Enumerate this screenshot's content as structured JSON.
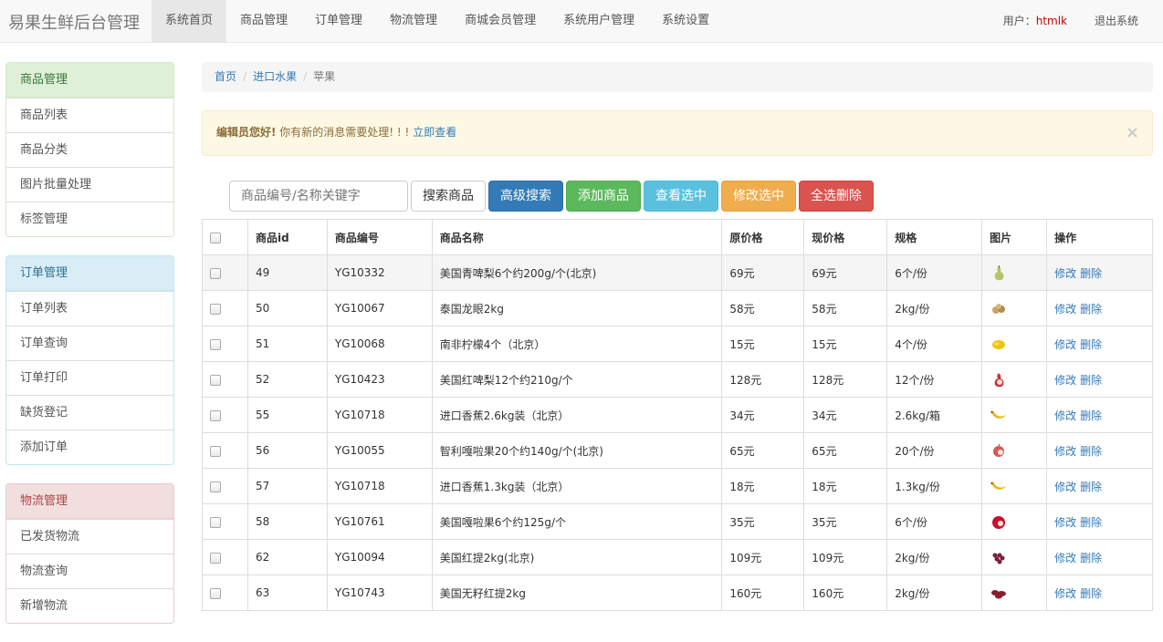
{
  "brand": "易果生鲜后台管理",
  "nav": {
    "items": [
      "系统首页",
      "商品管理",
      "订单管理",
      "物流管理",
      "商城会员管理",
      "系统用户管理",
      "系统设置"
    ],
    "active_index": 0,
    "user_label": "用户：",
    "username": "htmlk",
    "logout": "退出系统"
  },
  "sidebar": {
    "panels": [
      {
        "title": "商品管理",
        "items": [
          "商品列表",
          "商品分类",
          "图片批量处理",
          "标签管理"
        ]
      },
      {
        "title": "订单管理",
        "items": [
          "订单列表",
          "订单查询",
          "订单打印",
          "缺货登记",
          "添加订单"
        ]
      },
      {
        "title": "物流管理",
        "items": [
          "已发货物流",
          "物流查询",
          "新增物流"
        ]
      }
    ]
  },
  "breadcrumb": {
    "home": "首页",
    "category": "进口水果",
    "current": "苹果",
    "separator": "/"
  },
  "alert": {
    "bold": "编辑员您好!",
    "text": " 你有新的消息需要处理! ! ! ",
    "link": "立即查看",
    "close": "×"
  },
  "toolbar": {
    "search_placeholder": "商品编号/名称关键字",
    "search": "搜索商品",
    "advanced": "高级搜索",
    "add": "添加商品",
    "view": "查看选中",
    "edit": "修改选中",
    "delete": "全选删除"
  },
  "table": {
    "headers": [
      "商品id",
      "商品编号",
      "商品名称",
      "原价格",
      "现价格",
      "规格",
      "图片",
      "操作"
    ],
    "rows": [
      {
        "id": "49",
        "code": "YG10332",
        "name": "美国青啤梨6个约200g/个(北京)",
        "orig": "69元",
        "now": "69元",
        "spec": "6个/份",
        "icon": "pear"
      },
      {
        "id": "50",
        "code": "YG10067",
        "name": "泰国龙眼2kg",
        "orig": "58元",
        "now": "58元",
        "spec": "2kg/份",
        "icon": "longan"
      },
      {
        "id": "51",
        "code": "YG10068",
        "name": "南非柠檬4个（北京）",
        "orig": "15元",
        "now": "15元",
        "spec": "4个/份",
        "icon": "lemon"
      },
      {
        "id": "52",
        "code": "YG10423",
        "name": "美国红啤梨12个约210g/个",
        "orig": "128元",
        "now": "128元",
        "spec": "12个/份",
        "icon": "red-pear"
      },
      {
        "id": "55",
        "code": "YG10718",
        "name": "进口香蕉2.6kg装（北京）",
        "orig": "34元",
        "now": "34元",
        "spec": "2.6kg/箱",
        "icon": "banana"
      },
      {
        "id": "56",
        "code": "YG10055",
        "name": "智利嘎啦果20个约140g/个(北京)",
        "orig": "65元",
        "now": "65元",
        "spec": "20个/份",
        "icon": "apple"
      },
      {
        "id": "57",
        "code": "YG10718",
        "name": "进口香蕉1.3kg装（北京）",
        "orig": "18元",
        "now": "18元",
        "spec": "1.3kg/份",
        "icon": "banana"
      },
      {
        "id": "58",
        "code": "YG10761",
        "name": "美国嘎啦果6个约125g/个",
        "orig": "35元",
        "now": "35元",
        "spec": "6个/份",
        "icon": "red-apple"
      },
      {
        "id": "62",
        "code": "YG10094",
        "name": "美国红提2kg(北京)",
        "orig": "109元",
        "now": "109元",
        "spec": "2kg/份",
        "icon": "grapes"
      },
      {
        "id": "63",
        "code": "YG10743",
        "name": "美国无籽红提2kg",
        "orig": "160元",
        "now": "160元",
        "spec": "2kg/份",
        "icon": "red-grapes"
      }
    ],
    "edit_label": "修改",
    "delete_label": "删除"
  }
}
